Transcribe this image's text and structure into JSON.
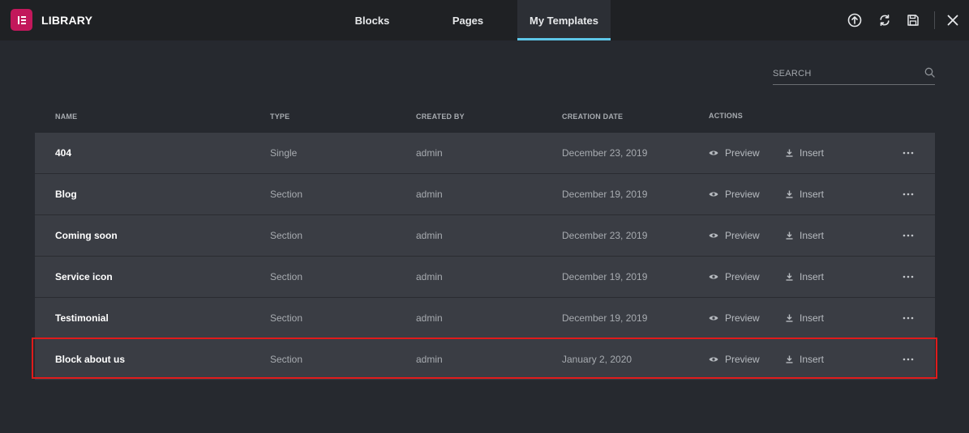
{
  "header": {
    "title": "LIBRARY",
    "logo_icon": "elementor-logo-icon",
    "tabs": [
      {
        "label": "Blocks"
      },
      {
        "label": "Pages"
      },
      {
        "label": "My Templates",
        "active": true
      }
    ],
    "tools": [
      "upload-icon",
      "sync-icon",
      "save-icon",
      "close-icon"
    ]
  },
  "search": {
    "placeholder": "SEARCH",
    "value": ""
  },
  "table": {
    "columns": [
      "NAME",
      "TYPE",
      "CREATED BY",
      "CREATION DATE",
      "ACTIONS"
    ],
    "preview_label": "Preview",
    "insert_label": "Insert",
    "rows": [
      {
        "name": "404",
        "type": "Single",
        "author": "admin",
        "date": "December 23, 2019"
      },
      {
        "name": "Blog",
        "type": "Section",
        "author": "admin",
        "date": "December 19, 2019"
      },
      {
        "name": "Coming soon",
        "type": "Section",
        "author": "admin",
        "date": "December 23, 2019"
      },
      {
        "name": "Service icon",
        "type": "Section",
        "author": "admin",
        "date": "December 19, 2019"
      },
      {
        "name": "Testimonial",
        "type": "Section",
        "author": "admin",
        "date": "December 19, 2019"
      },
      {
        "name": "Block about us",
        "type": "Section",
        "author": "admin",
        "date": "January 2, 2020",
        "highlighted": true
      }
    ]
  },
  "colors": {
    "brand": "#c2185b",
    "active_tab_underline": "#5ec7e8",
    "highlight_border": "#e01b1b",
    "row_bg": "#3a3d44",
    "page_bg": "#26292f"
  }
}
